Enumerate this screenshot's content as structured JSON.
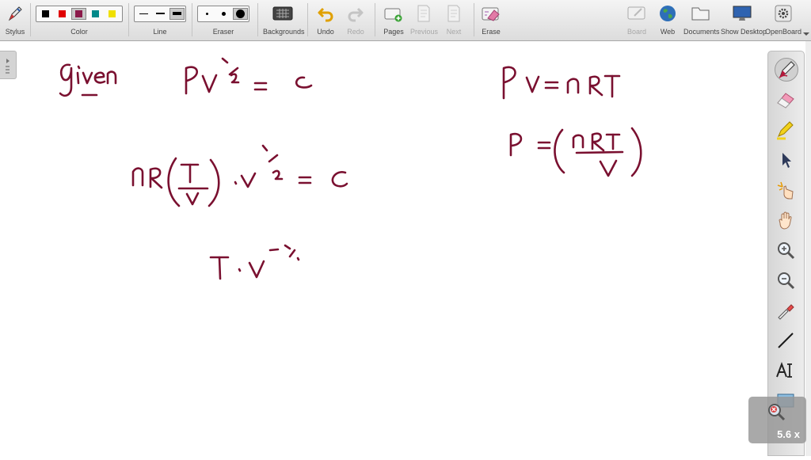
{
  "toolbar": {
    "stylus": "Stylus",
    "color": "Color",
    "line": "Line",
    "eraser": "Eraser",
    "backgrounds": "Backgrounds",
    "undo": "Undo",
    "redo": "Redo",
    "pages": "Pages",
    "previous": "Previous",
    "next": "Next",
    "erase": "Erase",
    "board": "Board",
    "web": "Web",
    "documents": "Documents",
    "show_desktop": "Show Desktop",
    "openboard": "OpenBoard"
  },
  "palette": [
    "#000000",
    "#e00000",
    "#8b1a4a",
    "#00898a",
    "#f0e000"
  ],
  "ink_color": "#7a1030",
  "sidebar_icons": [
    "pen-icon",
    "eraser-icon",
    "marker-icon",
    "pointer-icon",
    "laser-pointer-icon",
    "hand-icon",
    "zoom-in-icon",
    "zoom-out-icon",
    "color-picker-icon",
    "line-icon",
    "text-icon",
    "capture-icon"
  ],
  "zoom": {
    "level": "5.6 x"
  }
}
